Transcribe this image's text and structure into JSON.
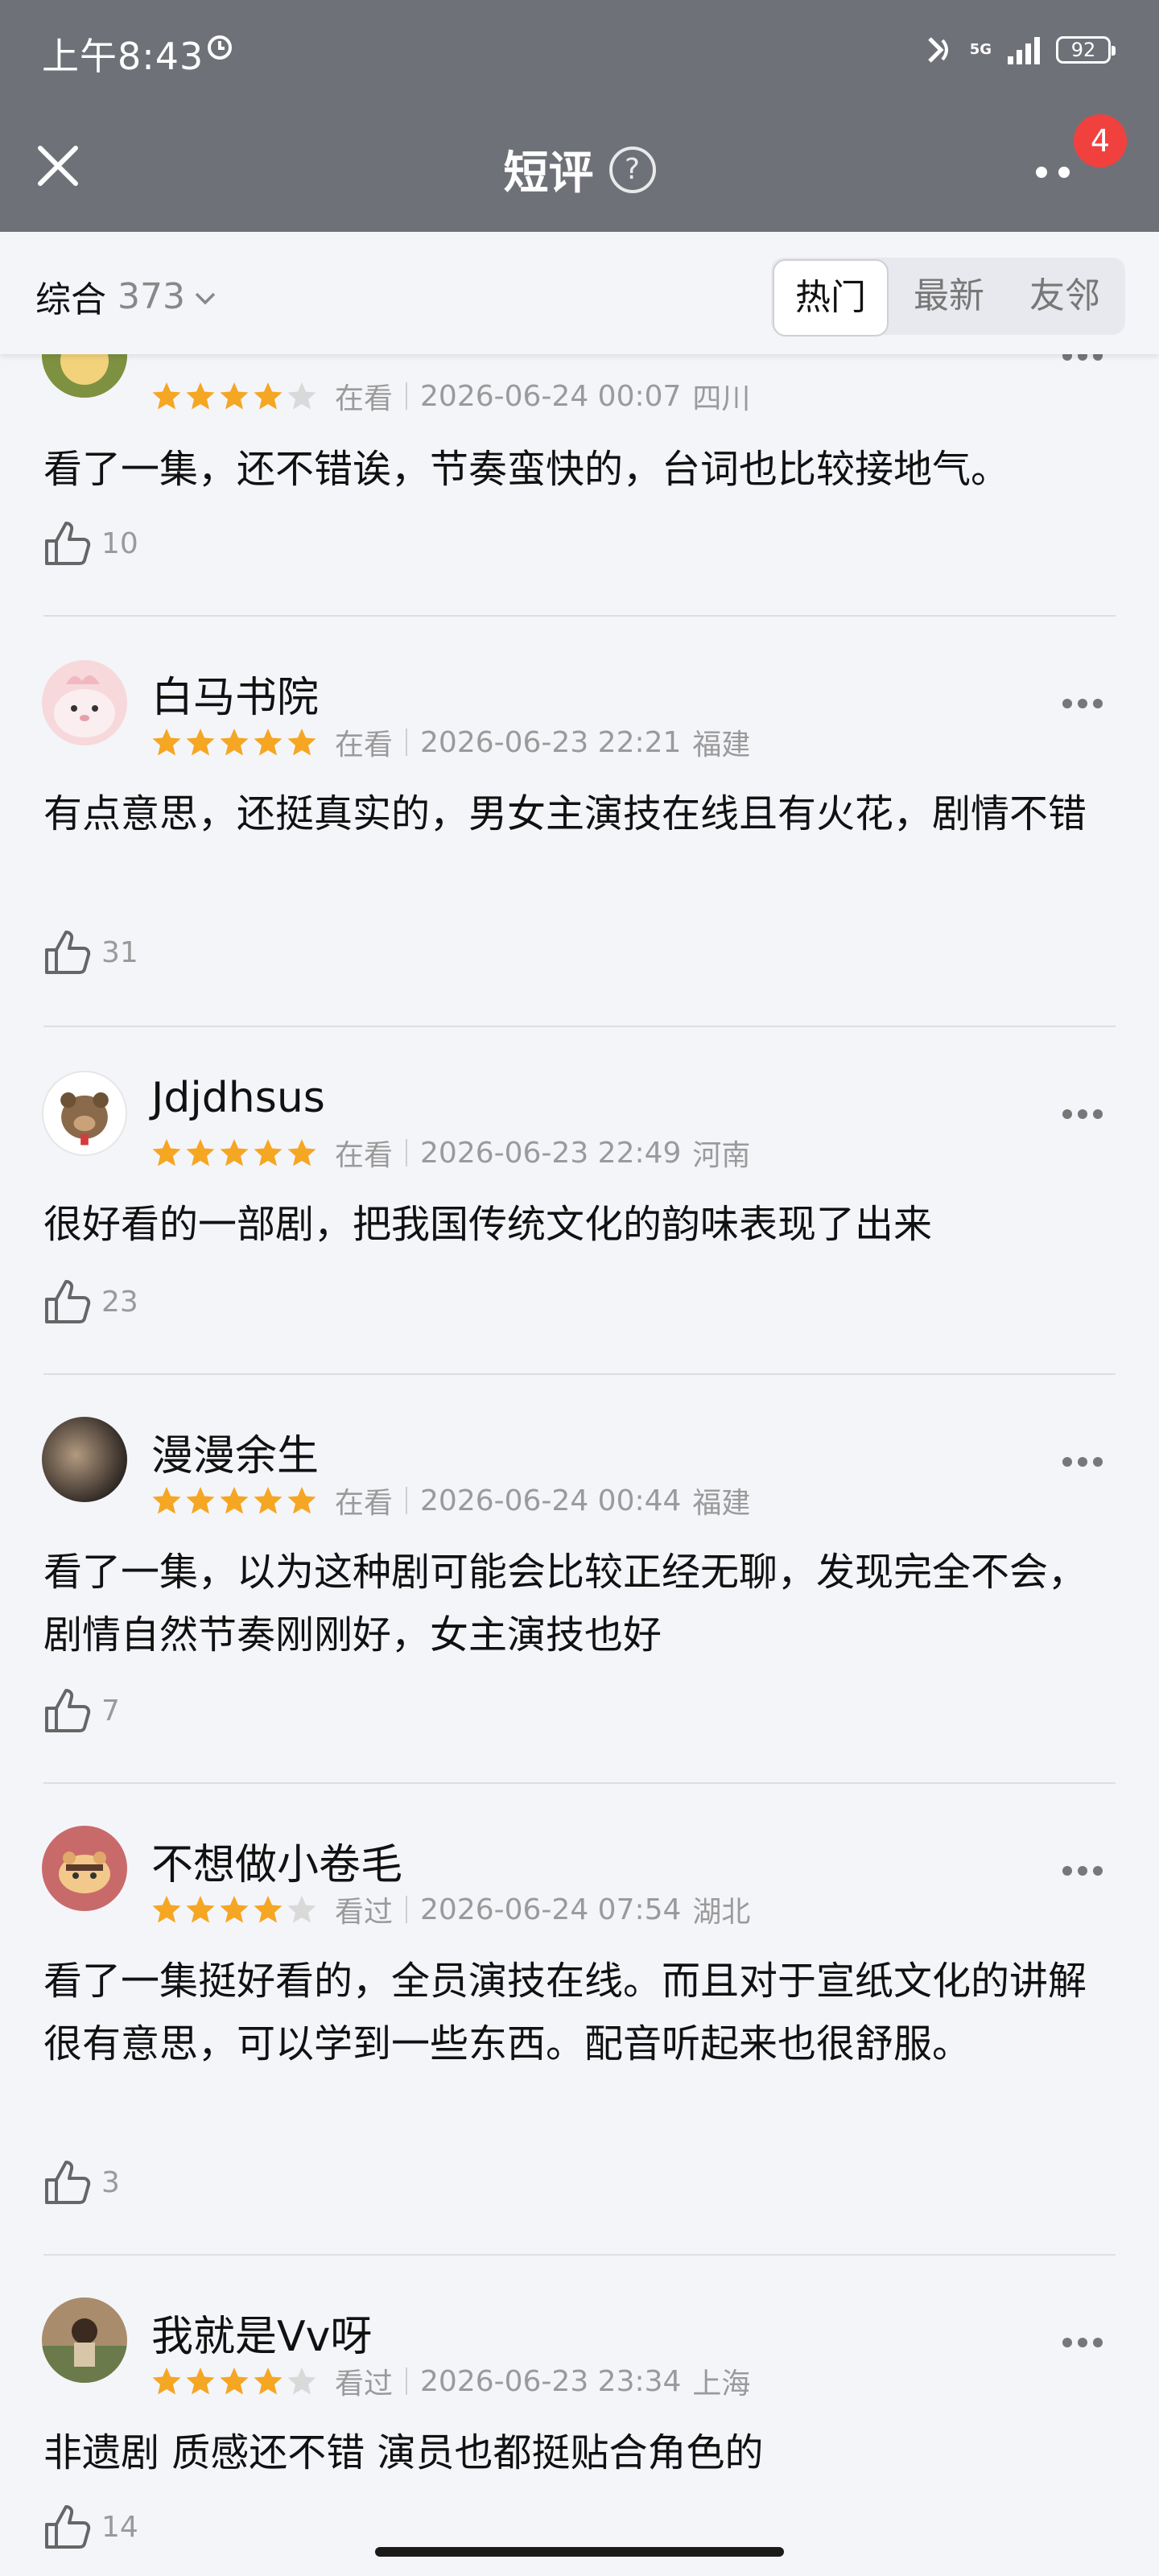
{
  "status_bar": {
    "time": "上午8:43",
    "network": "5G",
    "battery": "92"
  },
  "nav": {
    "title": "短评",
    "help": "?",
    "badge": "4"
  },
  "filter": {
    "sort_label": "综合",
    "count": "373",
    "tabs": [
      {
        "label": "热门",
        "active": true
      },
      {
        "label": "最新",
        "active": false
      },
      {
        "label": "友邻",
        "active": false
      }
    ]
  },
  "comments": [
    {
      "name": "",
      "rating": 4,
      "status": "在看",
      "date": "2026-06-24 00:07",
      "location": "四川",
      "text": "看了一集，还不错诶，节奏蛮快的，台词也比较接地气。",
      "likes": "10"
    },
    {
      "name": "白马书院",
      "rating": 5,
      "status": "在看",
      "date": "2026-06-23 22:21",
      "location": "福建",
      "text": "有点意思，还挺真实的，男女主演技在线且有火花，剧情不错",
      "likes": "31"
    },
    {
      "name": "Jdjdhsus",
      "rating": 5,
      "status": "在看",
      "date": "2026-06-23 22:49",
      "location": "河南",
      "text": "很好看的一部剧，把我国传统文化的韵味表现了出来",
      "likes": "23"
    },
    {
      "name": "漫漫余生",
      "rating": 5,
      "status": "在看",
      "date": "2026-06-24 00:44",
      "location": "福建",
      "text": "看了一集，以为这种剧可能会比较正经无聊，发现完全不会，剧情自然节奏刚刚好，女主演技也好",
      "likes": "7"
    },
    {
      "name": "不想做小卷毛",
      "rating": 4,
      "status": "看过",
      "date": "2026-06-24 07:54",
      "location": "湖北",
      "text": "看了一集挺好看的，全员演技在线。而且对于宣纸文化的讲解很有意思，可以学到一些东西。配音听起来也很舒服。",
      "likes": "3"
    },
    {
      "name": "我就是Vv呀",
      "rating": 4,
      "status": "看过",
      "date": "2026-06-23 23:34",
      "location": "上海",
      "text": "非遗剧 质感还不错 演员也都挺贴合角色的",
      "likes": "14"
    }
  ],
  "colors": {
    "star": "#f5a623",
    "star_empty": "#d9d9d9",
    "bar": "#6f7178",
    "badge": "#f1413f"
  }
}
